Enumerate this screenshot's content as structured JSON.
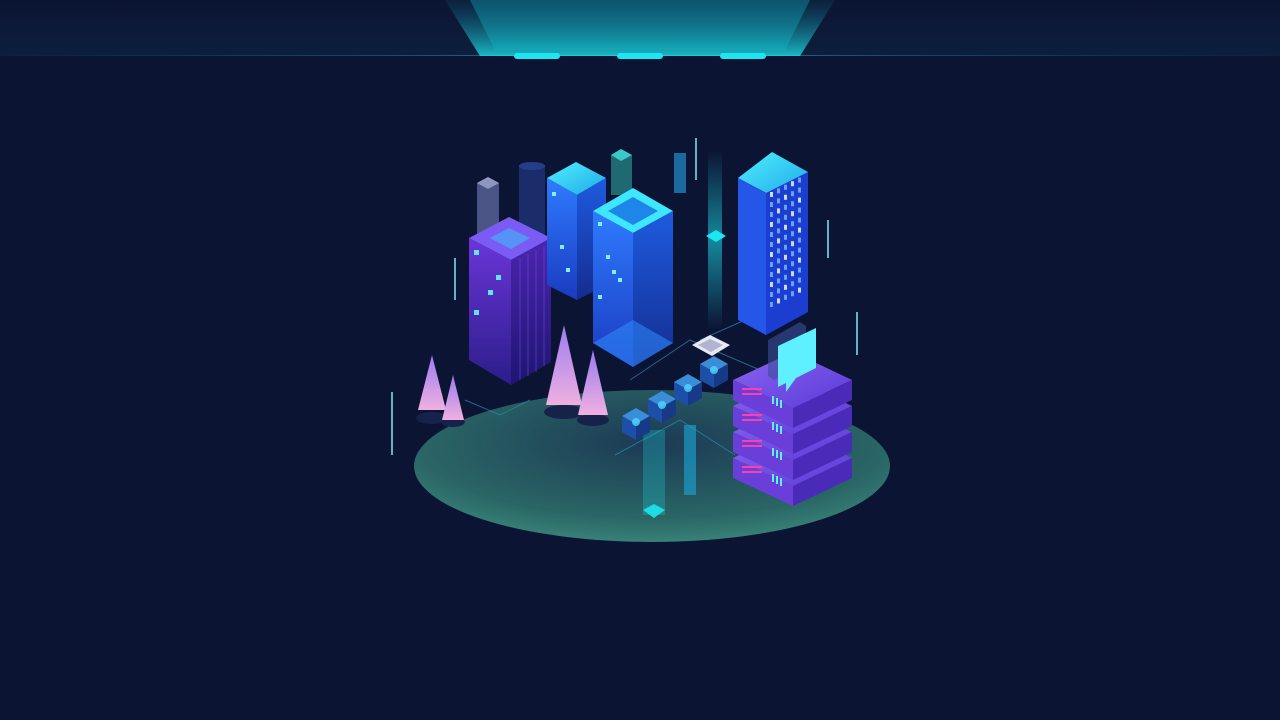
{
  "colors": {
    "background": "#0b1433",
    "accent_cyan": "#1de6f0",
    "accent_blue": "#2f6bff",
    "accent_purple": "#7a3cf0",
    "platform": "#2a6a6a"
  },
  "header": {
    "tabs": [
      {
        "icon": "indicator-pill"
      },
      {
        "icon": "indicator-pill"
      },
      {
        "icon": "indicator-pill"
      }
    ]
  },
  "scene": {
    "icons": [
      "smart-city-illustration",
      "server-stack-icon",
      "chat-bubble-icon",
      "chip-icon"
    ]
  }
}
